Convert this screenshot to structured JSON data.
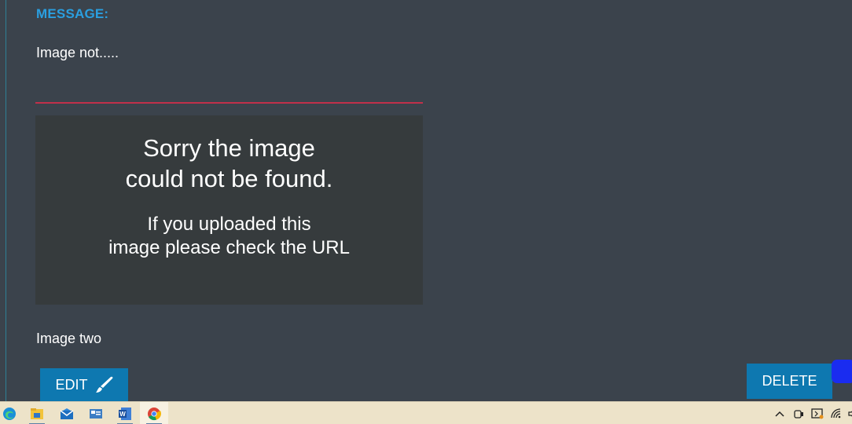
{
  "message": {
    "label": "MESSAGE:",
    "text": "Image not.....",
    "caption": "Image two"
  },
  "image_placeholder": {
    "title_line1": "Sorry the image",
    "title_line2": "could not be found.",
    "sub_line1": "If you uploaded this",
    "sub_line2": "image please check the URL"
  },
  "actions": {
    "edit_label": "EDIT",
    "delete_label": "DELETE"
  },
  "taskbar": {
    "apps": [
      "edge-icon",
      "file-explorer-icon",
      "mail-icon",
      "contacts-icon",
      "word-icon",
      "chrome-icon"
    ],
    "tray": [
      "chevron-up-icon",
      "meet-icon",
      "battery-icon",
      "wifi-icon",
      "speaker-icon"
    ]
  },
  "colors": {
    "background": "#3b434c",
    "accent": "#2a9fe0",
    "button": "#0e78b0",
    "divider": "#c0304a"
  }
}
